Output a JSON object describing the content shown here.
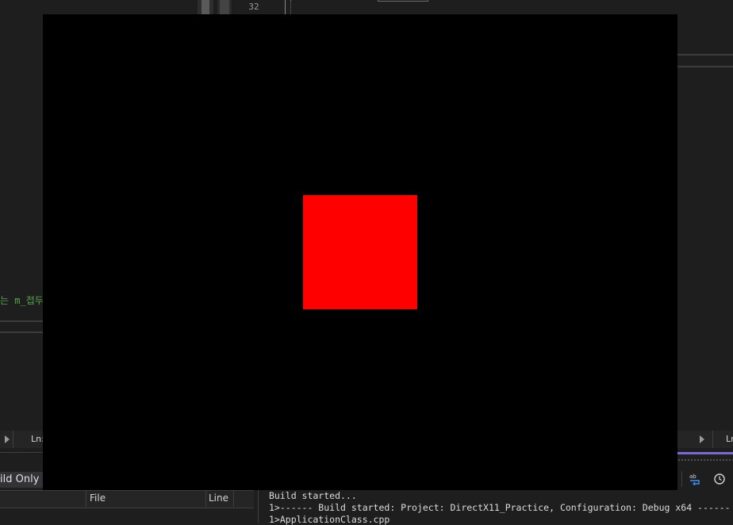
{
  "editor": {
    "line_number": "32",
    "code_fragment": "는 m_접두"
  },
  "status_bar": {
    "left_ln_label": "Ln:",
    "right_ln_label": "Ln:"
  },
  "error_list": {
    "filter_label": "ild Only",
    "columns": [
      "File",
      "Line"
    ]
  },
  "output": {
    "lines": [
      "Build started...",
      "1>------ Build started: Project: DirectX11_Practice, Configuration: Debug x64 ------",
      "1>ApplicationClass.cpp"
    ]
  },
  "toolbar": {
    "word_wrap_icon_text": "ab"
  },
  "game_window": {
    "background_color": "#000000",
    "square_color": "#ff0000"
  }
}
